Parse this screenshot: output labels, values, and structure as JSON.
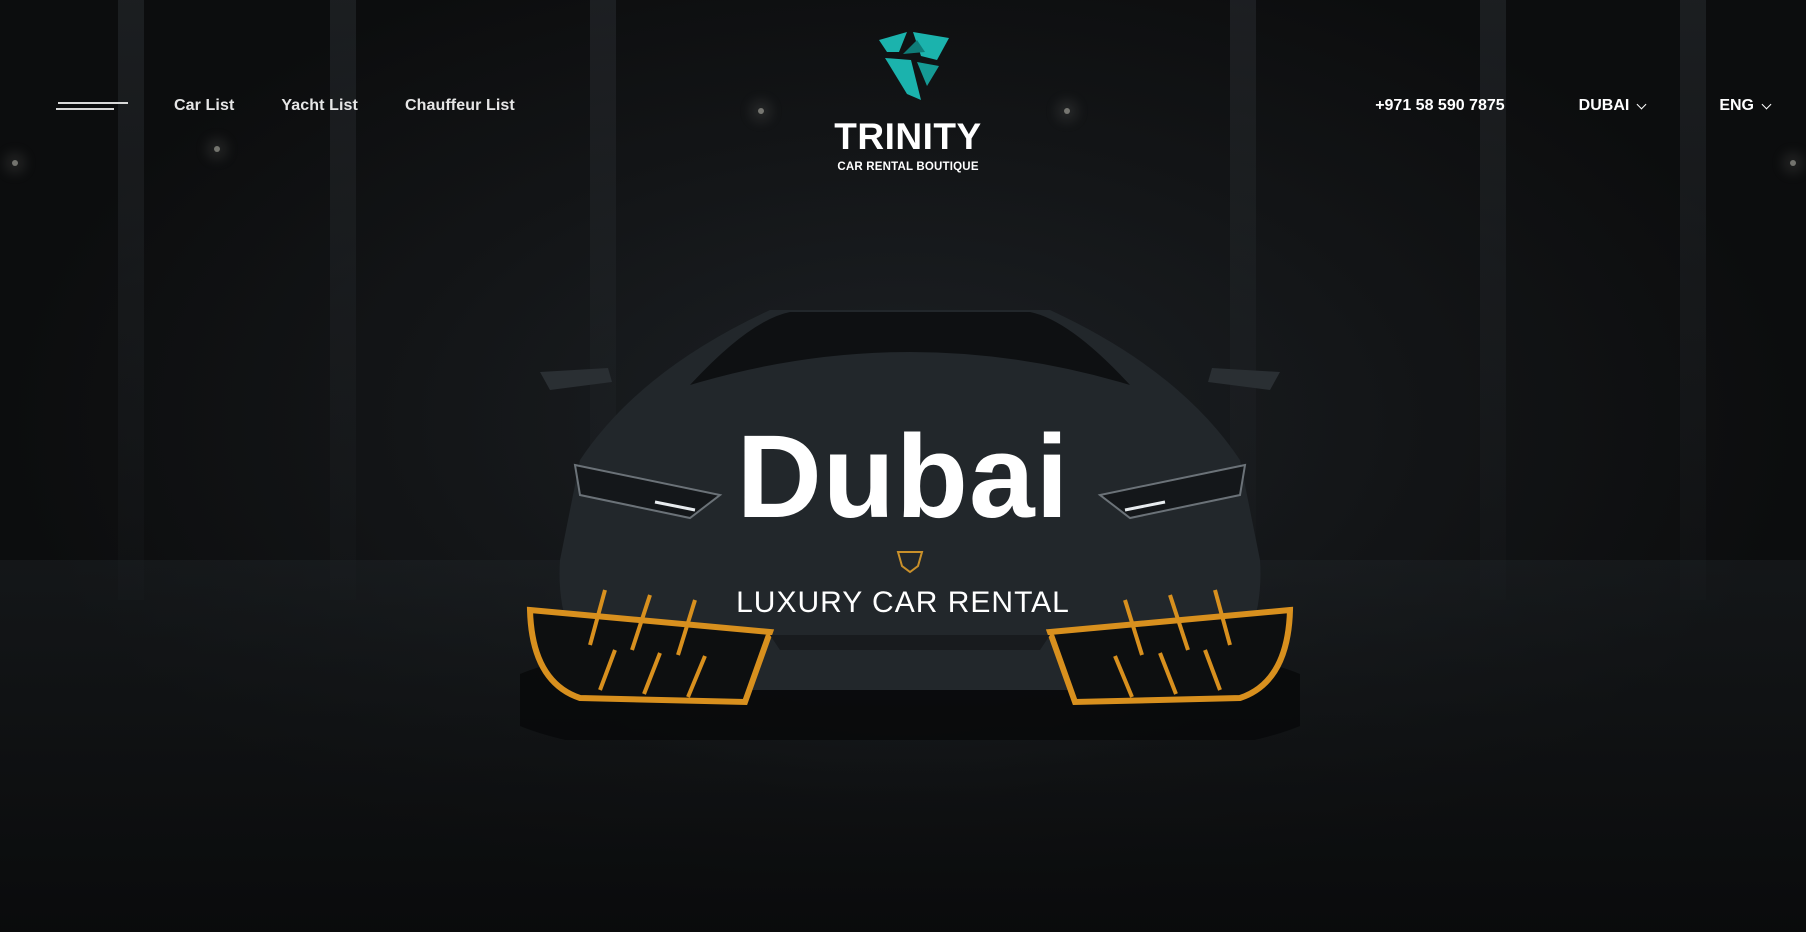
{
  "brand": {
    "name": "TRINITY",
    "tagline": "CAR RENTAL BOUTIQUE",
    "accent_color": "#1bb3ad"
  },
  "nav": {
    "menu_icon": "hamburger-menu-icon",
    "links": [
      {
        "label": "Car List"
      },
      {
        "label": "Yacht List"
      },
      {
        "label": "Chauffeur List"
      }
    ]
  },
  "header_right": {
    "phone": "+971 58 590 7875",
    "city": {
      "selected": "DUBAI",
      "icon": "chevron-down-icon"
    },
    "language": {
      "selected": "ENG",
      "icon": "chevron-down-icon"
    }
  },
  "hero": {
    "title": "Dubai",
    "subtitle": "LUXURY CAR RENTAL"
  },
  "colors": {
    "background": "#101214",
    "car_accent": "#d8901e",
    "text": "#ffffff"
  }
}
